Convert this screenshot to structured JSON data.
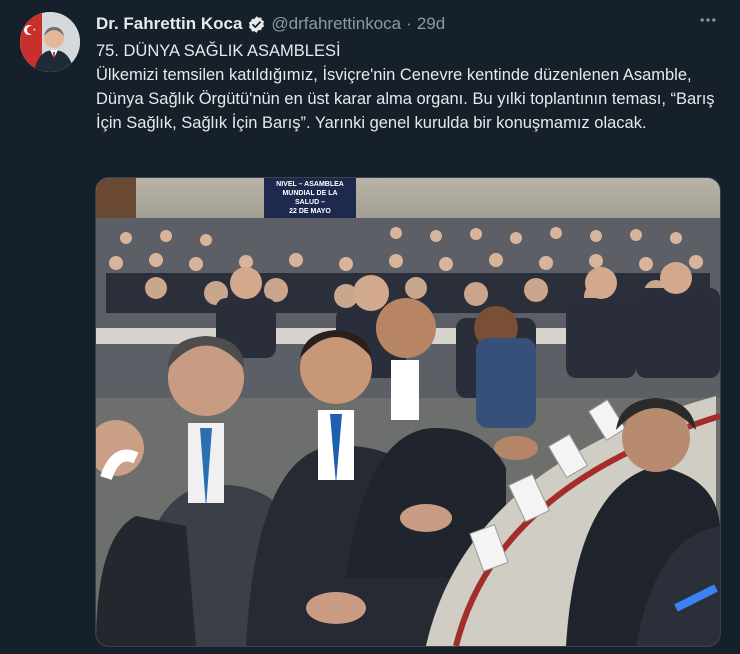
{
  "author": {
    "name": "Dr. Fahrettin Koca",
    "handle": "@drfahrettinkoca",
    "separator": "·",
    "time": "29d"
  },
  "tweet": {
    "title": "75. DÜNYA SAĞLIK ASAMBLESİ",
    "text": "Ülkemizi temsilen katıldığımız, İsviçre'nin Cenevre kentinde düzenlenen Asamble, Dünya Sağlık Örgütü'nün en üst karar alma organı. Bu yılki toplantının teması, “Barış İçin Sağlık, Sağlık İçin Barış”. Yarınki genel kurulda bir konuşmamız olacak."
  },
  "photo_screen": {
    "line1": "NIVEL – ASAMBLEA",
    "line2": "MUNDIAL DE LA",
    "line3": "SALUD –",
    "line4": "22 DE MAYO"
  },
  "colors": {
    "background": "#15202b",
    "text": "#e7e9ea",
    "muted": "#8b98a5",
    "verified": "#1d9bf0"
  },
  "icons": {
    "verified": "verified-badge-icon",
    "more": "more-options-icon"
  }
}
